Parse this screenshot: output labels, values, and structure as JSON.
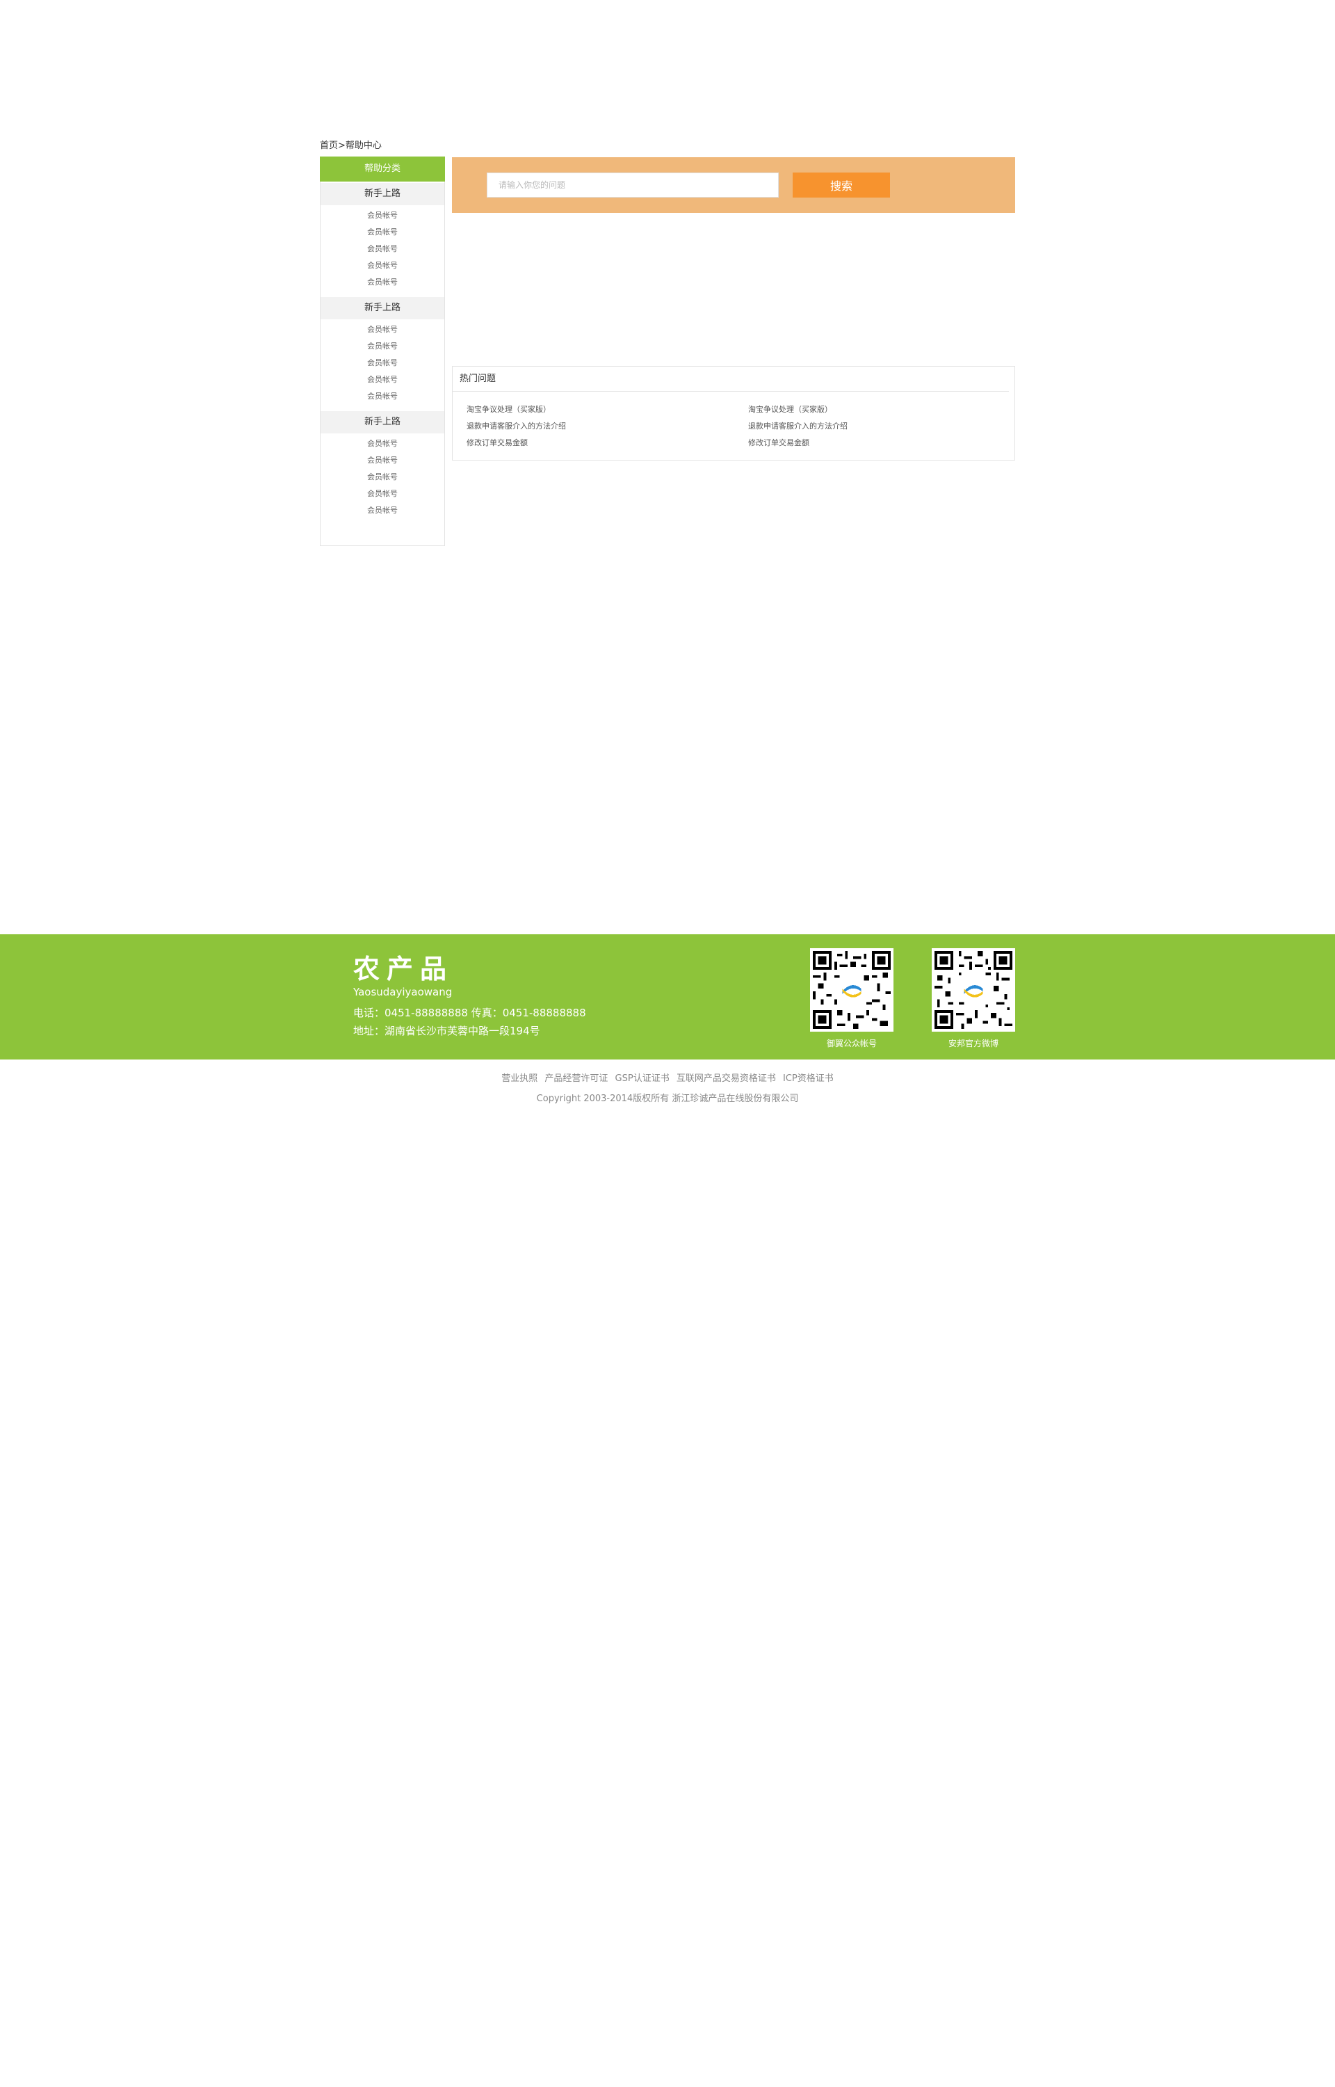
{
  "breadcrumb": {
    "home": "首页",
    "separator": ">",
    "current": "帮助中心"
  },
  "sidebar": {
    "header": "帮助分类",
    "groups": [
      {
        "title": "新手上路",
        "items": [
          "会员帐号",
          "会员帐号",
          "会员帐号",
          "会员帐号",
          "会员帐号"
        ]
      },
      {
        "title": "新手上路",
        "items": [
          "会员帐号",
          "会员帐号",
          "会员帐号",
          "会员帐号",
          "会员帐号"
        ]
      },
      {
        "title": "新手上路",
        "items": [
          "会员帐号",
          "会员帐号",
          "会员帐号",
          "会员帐号",
          "会员帐号"
        ]
      }
    ]
  },
  "search": {
    "placeholder": "请输入你您的问题",
    "button_label": "搜索"
  },
  "hot": {
    "title": "热门问题",
    "left": [
      "淘宝争议处理（买家版）",
      "退款申请客服介入的方法介绍",
      "修改订单交易金额"
    ],
    "right": [
      "淘宝争议处理（买家版）",
      "退款申请客服介入的方法介绍",
      "修改订单交易金额"
    ]
  },
  "footer": {
    "brand": "农产品",
    "brand_sub": "Yaosudayiyaowang",
    "phone": "电话：0451-88888888  传真：0451-88888888",
    "address": "地址：湖南省长沙市芙蓉中路一段194号",
    "qr1_label": "御翼公众帐号",
    "qr2_label": "安邦官方微博",
    "accent": "#8dc43a"
  },
  "bottom": {
    "links": [
      "营业执照",
      "产品经营许可证",
      "GSP认证证书",
      "互联网产品交易资格证书",
      "ICP资格证书"
    ],
    "copyright": "Copyright 2003-2014版权所有 浙江珍诚产品在线股份有限公司"
  }
}
